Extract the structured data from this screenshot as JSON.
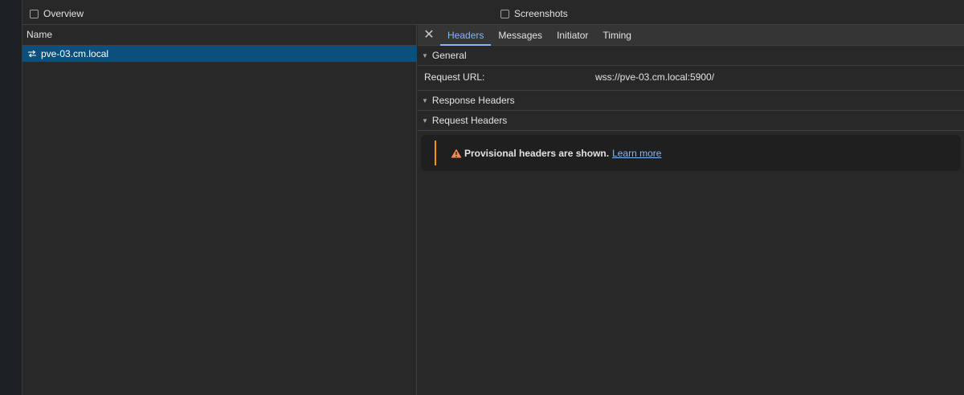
{
  "toolbar": {
    "overview_label": "Overview",
    "screenshots_label": "Screenshots"
  },
  "list": {
    "column_header": "Name",
    "rows": [
      {
        "name": "pve-03.cm.local",
        "icon": "websocket-icon",
        "selected": true
      }
    ]
  },
  "detail": {
    "close_icon": "close-icon",
    "tabs": [
      {
        "label": "Headers",
        "active": true
      },
      {
        "label": "Messages",
        "active": false
      },
      {
        "label": "Initiator",
        "active": false
      },
      {
        "label": "Timing",
        "active": false
      }
    ],
    "general": {
      "title": "General",
      "request_url_key": "Request URL:",
      "request_url_value": "wss://pve-03.cm.local:5900/"
    },
    "response_headers": {
      "title": "Response Headers"
    },
    "request_headers": {
      "title": "Request Headers",
      "notice_bold": "Provisional headers are shown.",
      "notice_link": "Learn more"
    }
  },
  "colors": {
    "accent": "#8ab4f8",
    "selection": "#0b4f7c",
    "warning": "#f29900"
  }
}
